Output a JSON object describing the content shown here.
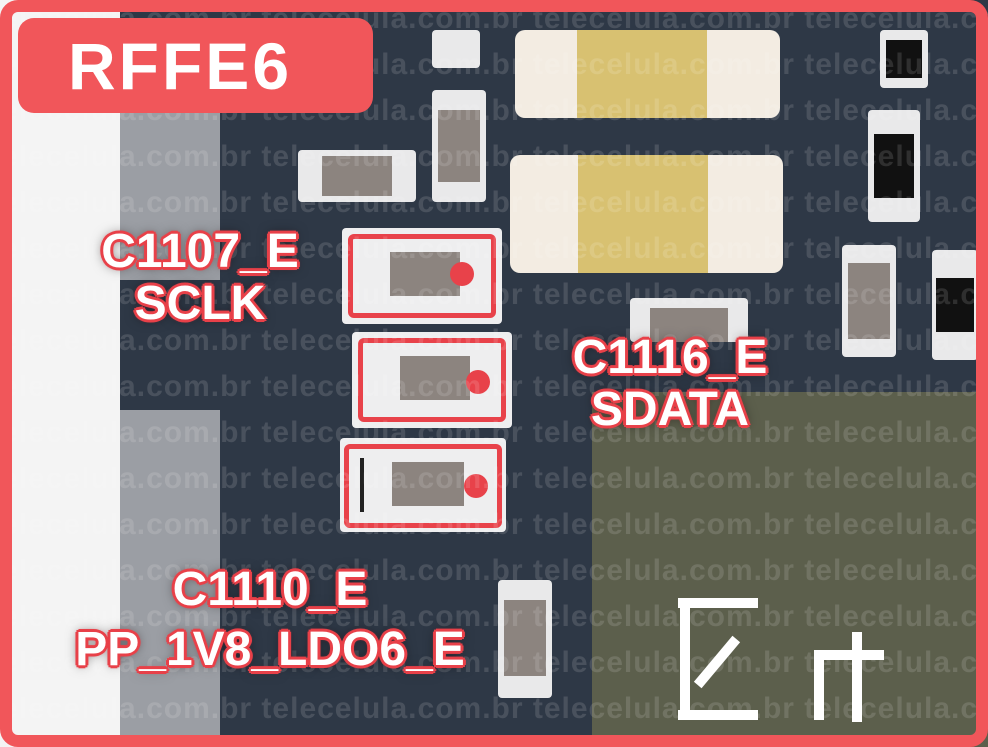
{
  "title": "RFFE6",
  "watermark": "telecelula.com.br",
  "labels": {
    "c1107": {
      "ref": "C1107_E",
      "net": "SCLK"
    },
    "c1116": {
      "ref": "C1116_E",
      "net": "SDATA"
    },
    "c1110": {
      "ref": "C1110_E",
      "net": "PP_1V8_LDO6_E"
    }
  },
  "colors": {
    "highlight": "#e8424a",
    "frame": "#f1565a",
    "board": "#2e3846",
    "label_text": "#ffffff"
  },
  "icons": [
    "marker-dot-icon"
  ]
}
